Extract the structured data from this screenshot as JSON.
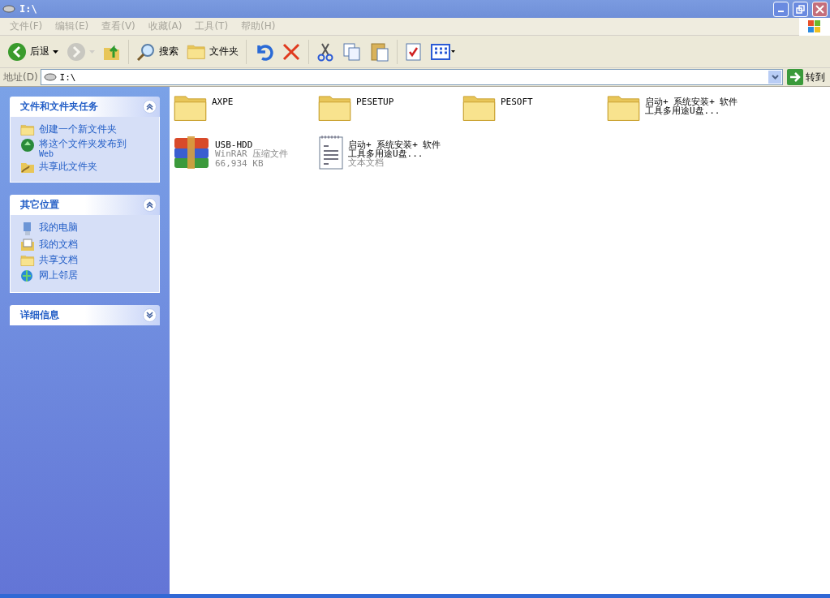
{
  "window": {
    "title": "I:\\"
  },
  "menu": [
    "文件(F)",
    "编辑(E)",
    "查看(V)",
    "收藏(A)",
    "工具(T)",
    "帮助(H)"
  ],
  "toolbar": [
    {
      "kind": "back",
      "label": "后退",
      "disabled": false
    },
    {
      "kind": "forward",
      "disabled": true
    },
    {
      "kind": "up",
      "disabled": false
    },
    {
      "kind": "search",
      "label": "搜索",
      "disabled": false
    },
    {
      "kind": "folders",
      "label": "文件夹",
      "disabled": false
    },
    {
      "kind": "undo",
      "disabled": false
    },
    {
      "kind": "delete",
      "disabled": false
    },
    {
      "kind": "cut",
      "disabled": false
    },
    {
      "kind": "copy",
      "disabled": false
    },
    {
      "kind": "paste",
      "disabled": false
    },
    {
      "kind": "properties",
      "disabled": false
    },
    {
      "kind": "views",
      "disabled": false
    }
  ],
  "address": {
    "label": "地址(D)",
    "value": "I:\\",
    "go": "转到"
  },
  "sidebar": [
    {
      "title": "文件和文件夹任务",
      "expanded": true,
      "items": [
        {
          "kind": "newfolder",
          "label": "创建一个新文件夹"
        },
        {
          "kind": "publish",
          "label": "将这个文件夹发布到",
          "sub": "Web"
        },
        {
          "kind": "share",
          "label": "共享此文件夹"
        }
      ]
    },
    {
      "title": "其它位置",
      "expanded": true,
      "items": [
        {
          "kind": "computer",
          "label": "我的电脑"
        },
        {
          "kind": "documents",
          "label": "我的文档"
        },
        {
          "kind": "folder",
          "label": "共享文档"
        },
        {
          "kind": "network",
          "label": "网上邻居"
        }
      ]
    },
    {
      "title": "详细信息",
      "expanded": false
    }
  ],
  "files": [
    {
      "kind": "folder",
      "name": "AXPE"
    },
    {
      "kind": "folder",
      "name": "PESETUP"
    },
    {
      "kind": "folder",
      "name": "PESOFT"
    },
    {
      "kind": "folder",
      "name": "启动+ 系统安装+ 软件工具多用途U盘..."
    },
    {
      "kind": "archive",
      "name": "USB-HDD",
      "type": "WinRAR 压缩文件",
      "size": "66,934 KB"
    },
    {
      "kind": "text",
      "name": "启动+ 系统安装+ 软件工具多用途U盘...",
      "type": "文本文档"
    }
  ]
}
